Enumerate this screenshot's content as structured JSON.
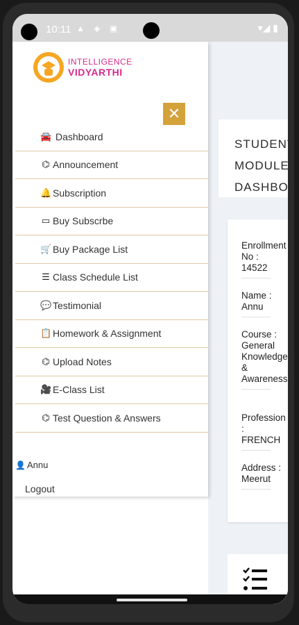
{
  "status": {
    "time": "10:11",
    "icons": "▲ ◈ ▣"
  },
  "logo": {
    "top": "INTELLIGENCE",
    "bottom": "VIDYARTHI"
  },
  "close_label": "✕",
  "menu": [
    {
      "label": "Dashboard",
      "icon": "🚘",
      "icon_name": "car-icon"
    },
    {
      "label": "Announcement",
      "icon": "⌬",
      "icon_name": "sitemap-icon"
    },
    {
      "label": "Subscription",
      "icon": "🔔",
      "icon_name": "bell-icon"
    },
    {
      "label": "Buy Subscrbe",
      "icon": "▭",
      "icon_name": "credit-card-icon"
    },
    {
      "label": "Buy Package List",
      "icon": "🛒",
      "icon_name": "cart-icon"
    },
    {
      "label": "Class Schedule List",
      "icon": "☰",
      "icon_name": "list-icon"
    },
    {
      "label": "Testimonial",
      "icon": "💬",
      "icon_name": "comments-icon"
    },
    {
      "label": "Homework & Assignment",
      "icon": "📋",
      "icon_name": "clipboard-icon"
    },
    {
      "label": "Upload Notes",
      "icon": "⌬",
      "icon_name": "sitemap-icon"
    },
    {
      "label": "E-Class List",
      "icon": "🎥",
      "icon_name": "video-icon"
    },
    {
      "label": "Test Question & Answers",
      "icon": "⌬",
      "icon_name": "sitemap-icon"
    }
  ],
  "user": {
    "name": "Annu",
    "icon": "👤"
  },
  "logout_label": "Logout",
  "dashboard": {
    "title": "STUDENT\nMODULE\nDASHBOARD",
    "info": [
      {
        "label": "Enrollment No :",
        "value": "14522"
      },
      {
        "label": "Name :",
        "value": "Annu"
      },
      {
        "label": "Course :",
        "value": "General Knowledge & Awareness"
      },
      {
        "label": "Profession :",
        "value": "FRENCH"
      },
      {
        "label": "Address :",
        "value": "Meerut"
      }
    ]
  },
  "colors": {
    "accent": "#d4a23a",
    "logo_orange": "#f5a623",
    "logo_magenta": "#d62a8c"
  }
}
